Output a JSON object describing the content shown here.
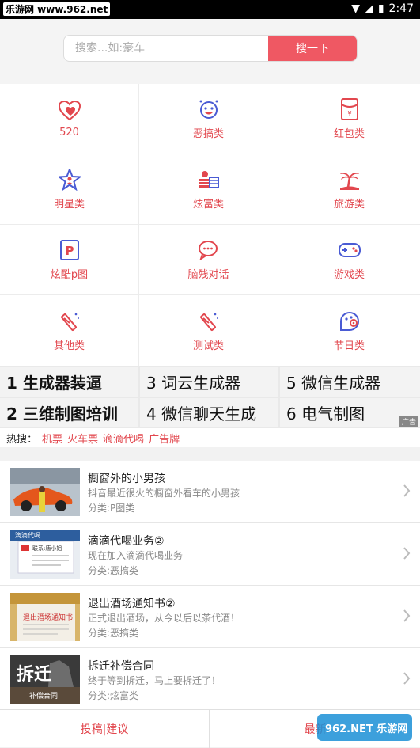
{
  "statusbar": {
    "watermark": "乐游网 www.962.net",
    "time": "2:47"
  },
  "search": {
    "placeholder": "搜索...如:豪车",
    "button": "搜一下"
  },
  "categories": [
    {
      "label": "520",
      "icon": "heart-icon"
    },
    {
      "label": "恶搞类",
      "icon": "funny-face-icon"
    },
    {
      "label": "红包类",
      "icon": "red-envelope-icon"
    },
    {
      "label": "明星类",
      "icon": "star-person-icon"
    },
    {
      "label": "炫富类",
      "icon": "money-stack-icon"
    },
    {
      "label": "旅游类",
      "icon": "palm-tree-icon"
    },
    {
      "label": "炫酷p图",
      "icon": "p-badge-icon"
    },
    {
      "label": "脑残对话",
      "icon": "chat-bubbles-icon"
    },
    {
      "label": "游戏类",
      "icon": "gamepad-icon"
    },
    {
      "label": "其他类",
      "icon": "wand-icon"
    },
    {
      "label": "测试类",
      "icon": "wand-icon"
    },
    {
      "label": "节日类",
      "icon": "holiday-icon"
    }
  ],
  "hot_links": [
    {
      "text": "1 生成器装逼",
      "bold": true
    },
    {
      "text": "3 词云生成器",
      "bold": false
    },
    {
      "text": "5 微信生成器",
      "bold": false
    },
    {
      "text": "2 三维制图培训",
      "bold": true
    },
    {
      "text": "4 微信聊天生成",
      "bold": false
    },
    {
      "text": "6 电气制图",
      "bold": false
    }
  ],
  "ad_label": "广告",
  "hot_search": {
    "label": "热搜：",
    "terms": [
      "机票",
      "火车票",
      "滴滴代喝",
      "广告牌"
    ]
  },
  "items": [
    {
      "title": "橱窗外的小男孩",
      "desc": "抖音最近很火的橱窗外看车的小男孩",
      "category": "分类:P图类"
    },
    {
      "title": "滴滴代喝业务②",
      "desc": "现在加入滴滴代喝业务",
      "category": "分类:恶搞类"
    },
    {
      "title": "退出酒场通知书②",
      "desc": "正式退出酒场，从今以后以茶代酒！",
      "category": "分类:恶搞类"
    },
    {
      "title": "拆迁补偿合同",
      "desc": "终于等到拆迁，马上要拆迁了！",
      "category": "分类:炫富类"
    }
  ],
  "thumb_text": {
    "didi": "滴滴代喝",
    "didi_sub": "联系:唐小姐",
    "notice": "退出酒场通知书",
    "chaiqian": "拆迁",
    "chaiqian_sub": "补偿合同"
  },
  "bottom": {
    "left": "投稿|建议",
    "right": "最新"
  },
  "watermark_logo": "962.NET 乐游网",
  "colors": {
    "accent": "#ef5863",
    "label": "#e2474e",
    "icon_blue": "#4a5bd4"
  }
}
